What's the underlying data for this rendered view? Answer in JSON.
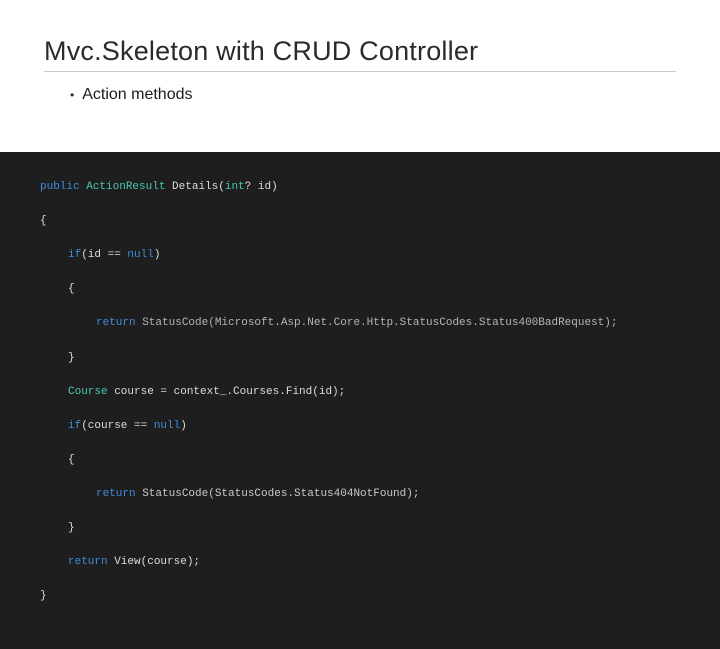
{
  "slide": {
    "title": "Mvc.Skeleton with CRUD Controller",
    "bullet": "Action methods"
  },
  "code": {
    "l1_kw1": "public",
    "l1_type": "ActionResult",
    "l1_name": "Details(",
    "l1_ptype": "int",
    "l1_q": "? id)",
    "l2": "{",
    "l3_kw": "if",
    "l3_rest_a": "(id == ",
    "l3_null": "null",
    "l3_rest_b": ")",
    "l4": "{",
    "l5_kw": "return",
    "l5_rest": " StatusCode(Microsoft.Asp.Net.Core.Http.StatusCodes.Status400BadRequest);",
    "l6": "}",
    "l7_type": "Course",
    "l7_rest": " course = context_.Courses.Find(id);",
    "l8_kw": "if",
    "l8_rest_a": "(course == ",
    "l8_null": "null",
    "l8_rest_b": ")",
    "l9": "{",
    "l10_kw": "return",
    "l10_rest": " StatusCode(StatusCodes.Status404NotFound);",
    "l11": "}",
    "l12_kw": "return",
    "l12_rest": " View(course);",
    "l13": "}"
  }
}
